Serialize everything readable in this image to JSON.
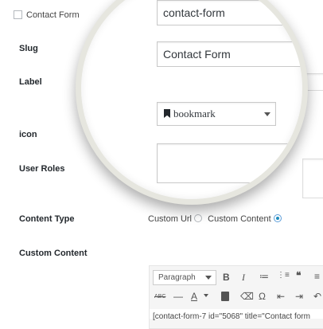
{
  "header": {
    "checkbox_label": "Contact Form"
  },
  "fields": {
    "slug": {
      "label": "Slug",
      "value": "contact-form"
    },
    "label": {
      "label": "Label",
      "value": "Contact Form"
    },
    "icon": {
      "label": "icon",
      "value": "bookmark"
    },
    "user_roles": {
      "label": "User Roles"
    },
    "content_type": {
      "label": "Content Type",
      "options": [
        "Custom Url",
        "Custom Content"
      ],
      "selected": "Custom Content"
    },
    "custom_content": {
      "label": "Custom Content"
    }
  },
  "editor": {
    "format_select": "Paragraph",
    "toolbar1": [
      "B",
      "I",
      "≔",
      "⋮≡",
      "❝",
      "≡"
    ],
    "toolbar2": [
      "ABC",
      "—",
      "A",
      "⌫",
      "Ω",
      "⇤",
      "⇥",
      "↶"
    ],
    "content_preview": "[contact-form-7 id=\"5068\" title=\"Contact form"
  }
}
